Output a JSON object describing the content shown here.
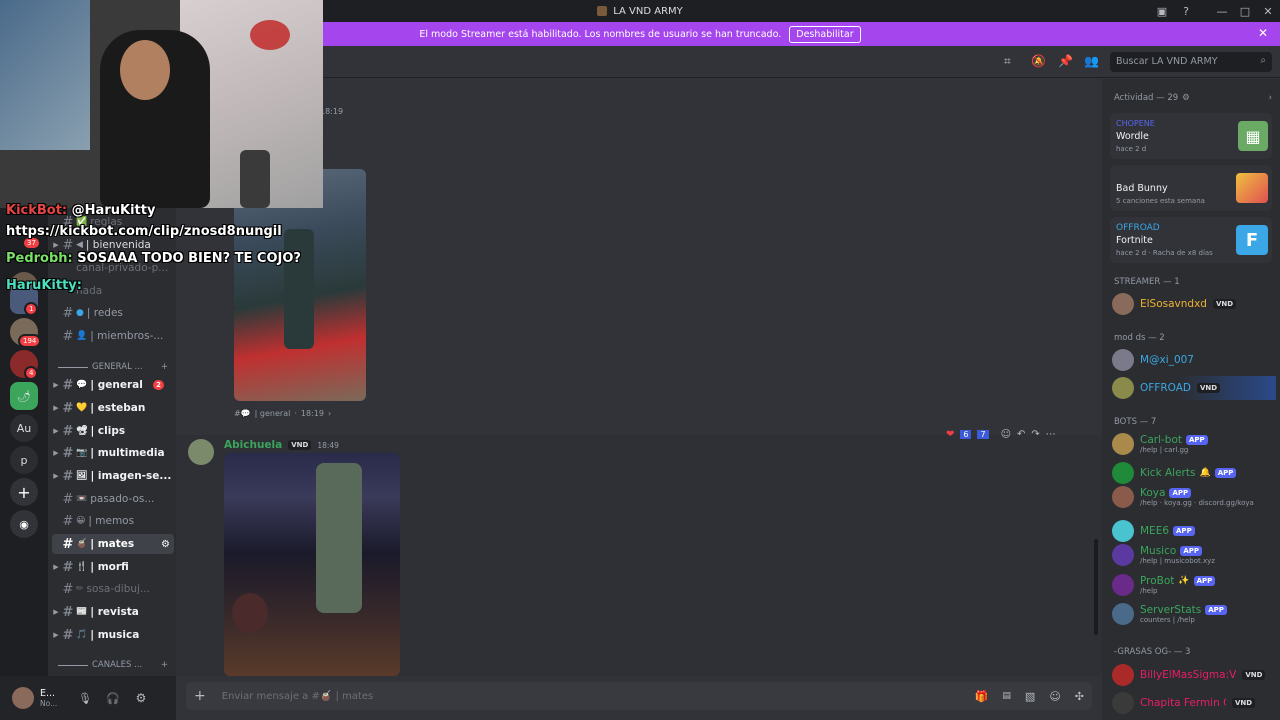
{
  "window": {
    "title": "LA VND ARMY"
  },
  "banner": {
    "text": "El modo Streamer está habilitado. Los nombres de usuario se han truncado.",
    "button": "Deshabilitar"
  },
  "servers": {
    "badges": [
      "37",
      "1",
      "194",
      "4"
    ],
    "au_label": "Au",
    "p_label": "p"
  },
  "channels": {
    "items": [
      {
        "label": "reglas",
        "emoji": "✅",
        "style": "dim"
      },
      {
        "label": "| bienvenida",
        "emoji": "◀",
        "style": "normal"
      },
      {
        "label": "canal-privado-p...",
        "emoji": "",
        "style": "dim"
      },
      {
        "label": "nada",
        "emoji": "",
        "style": "dim"
      },
      {
        "label": "| redes",
        "emoji": "●",
        "style": "normal"
      },
      {
        "label": "| miembros-...",
        "emoji": "👤",
        "style": "normal"
      }
    ],
    "category_general": "GENERAL ...",
    "items2": [
      {
        "label": "| general",
        "emoji": "💬",
        "style": "bright",
        "badge": "2"
      },
      {
        "label": "| esteban",
        "emoji": "💛",
        "style": "bright"
      },
      {
        "label": "| clips",
        "emoji": "📽",
        "style": "bright"
      },
      {
        "label": "| multimedia",
        "emoji": "📷",
        "style": "bright"
      },
      {
        "label": "| imagen-se...",
        "emoji": "🖼",
        "style": "bright"
      },
      {
        "label": "pasado-os...",
        "emoji": "📼",
        "style": "normal"
      },
      {
        "label": "| memos",
        "emoji": "😀",
        "style": "normal"
      },
      {
        "label": "| mates",
        "emoji": "🧉",
        "style": "active"
      },
      {
        "label": "| morfi",
        "emoji": "🍴",
        "style": "bright"
      },
      {
        "label": "sosa-dibuj...",
        "emoji": "✏",
        "style": "dim"
      },
      {
        "label": "| revista",
        "emoji": "📰",
        "style": "bright"
      },
      {
        "label": "| musica",
        "emoji": "🎵",
        "style": "bright"
      }
    ],
    "category_canales": "CANALES ..."
  },
  "user": {
    "name": "E...",
    "status": "No..."
  },
  "header": {
    "search_placeholder": "Buscar LA VND ARMY"
  },
  "chat": {
    "first_time": "18:19",
    "reply_ref": {
      "channel": "| general",
      "time": "18:19"
    },
    "message": {
      "author": "Abichuela",
      "tag": "VND",
      "time": "18:49",
      "reactions": [
        {
          "emoji": "❤",
          "count": "6"
        },
        {
          "emoji": "7",
          "count": "7"
        }
      ]
    },
    "composer_placeholder": "Enviar mensaje a #🧉 | mates"
  },
  "overlay": {
    "line1_name": "KickBot:",
    "line1_text": "@HaruKitty",
    "line2": "https://kickbot.com/clip/znosd8nungil",
    "line3_name": "Pedrobh:",
    "line3_text": "SOSAAA TODO BIEN? TE COJO?",
    "line4_name": "HaruKitty:"
  },
  "members": {
    "activity_header": "Actividad — 29",
    "activities": [
      {
        "user": "CHOPENE",
        "game": "Wordle",
        "detail": "hace 2 d"
      },
      {
        "user": "",
        "game": "Bad Bunny",
        "detail": "5 canciones esta semana"
      },
      {
        "user": "OFFROAD",
        "game": "Fortnite",
        "detail": "hace 2 d · Racha de x8 días"
      }
    ],
    "streamer_header": "STREAMER — 1",
    "streamer": [
      {
        "name": "ElSosavndxd",
        "tag": "VND",
        "color": "#f0b232"
      }
    ],
    "mods_header": "mod ds — 2",
    "mods": [
      {
        "name": "M@xi_007",
        "color": "#3ba7e6"
      },
      {
        "name": "OFFROAD",
        "tag": "VND",
        "color": "#3ba7e6"
      }
    ],
    "bots_header": "BOTS — 7",
    "bots": [
      {
        "name": "Carl-bot",
        "sub": "/help | carl.gg"
      },
      {
        "name": "Kick Alerts",
        "sub": ""
      },
      {
        "name": "Koya",
        "sub": "/help · koya.gg · discord.gg/koya"
      },
      {
        "name": "MEE6",
        "sub": ""
      },
      {
        "name": "Musico",
        "sub": "/help | musicobot.xyz"
      },
      {
        "name": "ProBot",
        "sub": "/help"
      },
      {
        "name": "ServerStats",
        "sub": "counters | /help"
      }
    ],
    "app_label": "APP",
    "grasas_header": "-GRASAS OG- — 3",
    "grasas": [
      {
        "name": "BillyElMasSigma:V",
        "tag": "VND"
      },
      {
        "name": "Chapita Fermin C...",
        "tag": "VND"
      }
    ]
  },
  "colors": {
    "accent": "#a445ed",
    "brand": "#5865f2",
    "bot_green": "#3ba55c",
    "grasas": "#e91e63"
  }
}
